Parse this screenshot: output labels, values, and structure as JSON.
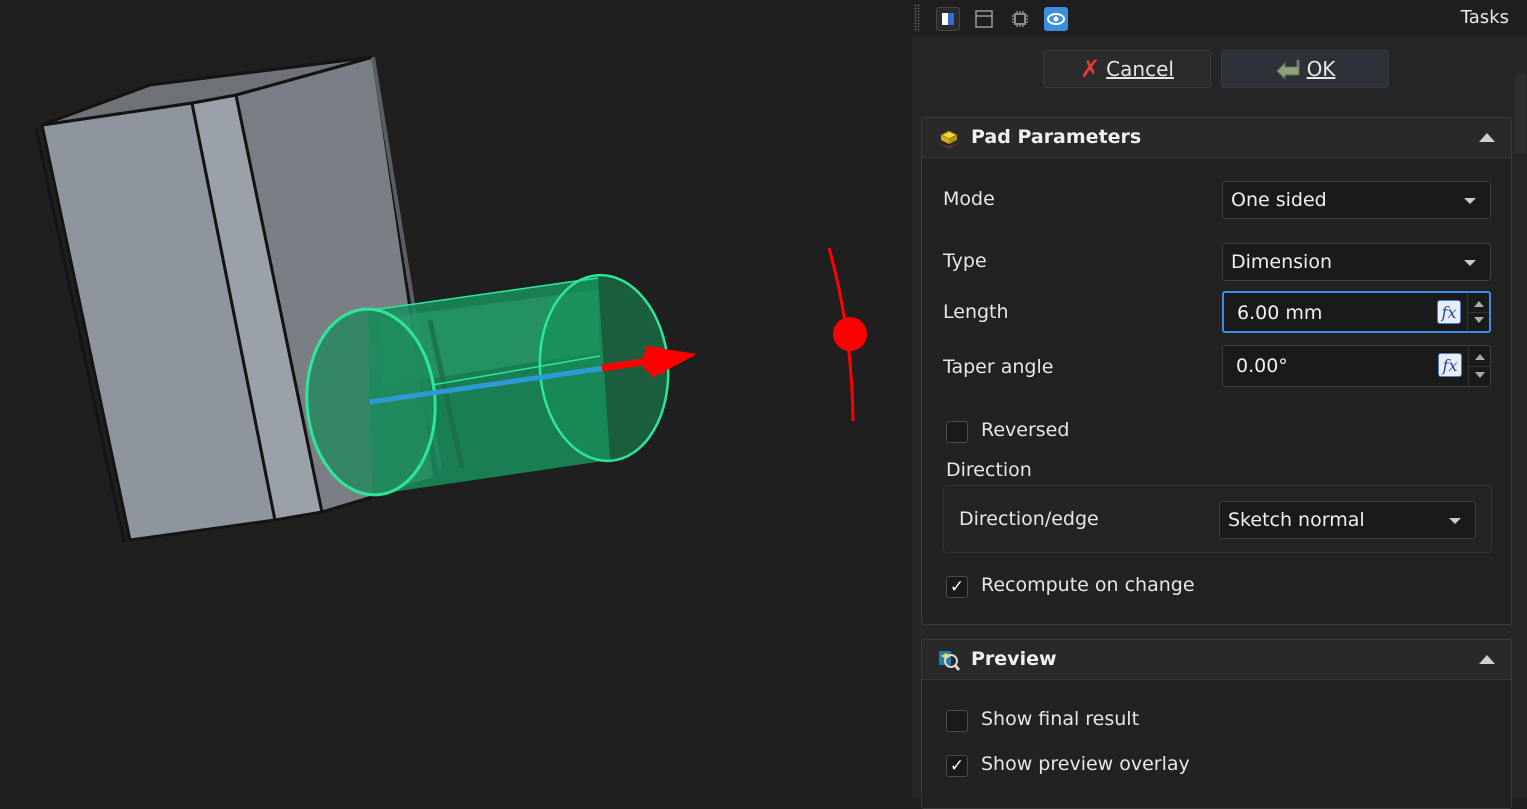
{
  "taskpanel": {
    "title": "Tasks",
    "toolbar_icons": [
      "combo-view-icon",
      "model-view-icon",
      "settings-icon",
      "visibility-icon"
    ],
    "cancel_label": "Cancel",
    "ok_label": "OK"
  },
  "pad": {
    "title": "Pad Parameters",
    "mode_label": "Mode",
    "mode_value": "One sided",
    "type_label": "Type",
    "type_value": "Dimension",
    "length_label": "Length",
    "length_value": "6.00 mm",
    "taper_label": "Taper angle",
    "taper_value": "0.00°",
    "fx_label": "fx",
    "reversed_label": "Reversed",
    "reversed_checked": false,
    "direction_group": "Direction",
    "direction_edge_label": "Direction/edge",
    "direction_edge_value": "Sketch normal",
    "recompute_label": "Recompute on change",
    "recompute_checked": true
  },
  "preview": {
    "title": "Preview",
    "final_result_label": "Show final result",
    "final_result_checked": false,
    "overlay_label": "Show preview overlay",
    "overlay_checked": true
  },
  "check_glyph": "✓",
  "colors": {
    "accent": "#3b8ee0",
    "preview_green": "#2ee69a",
    "dragger_red": "#ff0000",
    "axis_blue": "#2d9ad8"
  }
}
